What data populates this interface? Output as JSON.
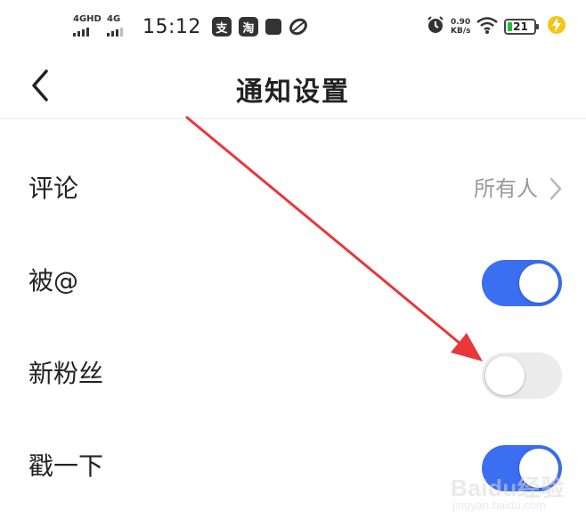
{
  "status_bar": {
    "network_1": "4GHD",
    "network_2": "4G",
    "time": "15:12",
    "app_icon_1": "支",
    "app_icon_2": "淘",
    "speed_value": "0.90",
    "speed_unit": "KB/s",
    "battery": "21",
    "icons": [
      "signal-icon",
      "alipay-icon",
      "taobao-icon",
      "app-square-icon",
      "app-ring-icon",
      "alarm-icon",
      "wifi-icon",
      "battery-icon",
      "charging-icon"
    ]
  },
  "nav": {
    "title": "通知设置"
  },
  "settings": {
    "comment": {
      "label": "评论",
      "value": "所有人"
    },
    "mention": {
      "label": "被@",
      "enabled": true
    },
    "new_fans": {
      "label": "新粉丝",
      "enabled": false
    },
    "poke": {
      "label": "戳一下",
      "enabled": true
    }
  },
  "colors": {
    "toggle_on": "#3b6ef0",
    "toggle_off": "#ebebeb",
    "annotation_arrow": "#e8363a"
  },
  "watermark": {
    "logo": "Baidu经验",
    "url": "jingyan.baidu.com"
  }
}
